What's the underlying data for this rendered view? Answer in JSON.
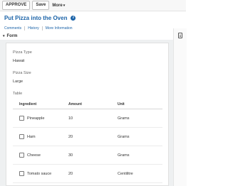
{
  "toolbar": {
    "approve_label": "APPROVE",
    "save_label": "Save",
    "more_label": "More",
    "more_caret": "▾"
  },
  "header": {
    "title": "Put Pizza into the Oven",
    "info_glyph": "i"
  },
  "links": [
    "Comments",
    "History",
    "More Information"
  ],
  "form": {
    "section_label": "Form",
    "section_chevron": "▾",
    "fields": [
      {
        "label": "Pizza Type",
        "value": "Hawaii"
      },
      {
        "label": "Pizza Size",
        "value": "Large"
      }
    ],
    "table_label": "Table",
    "table": {
      "columns": [
        "Ingredient",
        "Amount",
        "Unit"
      ],
      "rows": [
        {
          "ingredient": "Pineapple",
          "amount": "10",
          "unit": "Grams"
        },
        {
          "ingredient": "Ham",
          "amount": "20",
          "unit": "Grams"
        },
        {
          "ingredient": "Cheese",
          "amount": "30",
          "unit": "Grams"
        },
        {
          "ingredient": "Tomato sauce",
          "amount": "20",
          "unit": "Centilitre"
        }
      ]
    }
  },
  "side_panel": {
    "icon": "document-icon"
  },
  "colors": {
    "accent": "#1b63a8",
    "panel_bg": "#eef0f1"
  }
}
